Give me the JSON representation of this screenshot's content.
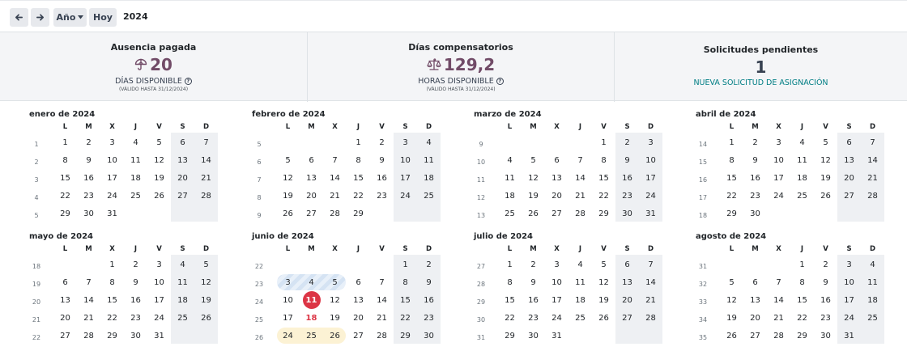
{
  "toolbar": {
    "prev_icon": "arrow-left-icon",
    "next_icon": "arrow-right-icon",
    "scale_label": "Año",
    "today_label": "Hoy",
    "year": "2024"
  },
  "summary": {
    "paid": {
      "title": "Ausencia pagada",
      "icon": "umbrella-icon",
      "value": "20",
      "unit": "DÍAS DISPONIBLE",
      "valid": "(VÁLIDO HASTA 31/12/2024)"
    },
    "comp": {
      "title": "Días compensatorios",
      "icon": "scale-icon",
      "value": "129,2",
      "unit": "HORAS DISPONIBLE",
      "valid": "(VÁLIDO HASTA 31/12/2024)"
    },
    "pending": {
      "title": "Solicitudes pendientes",
      "value": "1",
      "link": "NUEVA SOLICITUD DE ASIGNACIÓN"
    }
  },
  "colors": {
    "accent": "#714b67",
    "link": "#017e84",
    "today": "#dc3545",
    "weekend": "#eef0f3"
  },
  "weekday_headers": [
    "L",
    "M",
    "X",
    "J",
    "V",
    "S",
    "D"
  ],
  "months": [
    {
      "title": "enero de 2024",
      "offset": 0,
      "days": 31,
      "weeks": [
        "1",
        "2",
        "3",
        "4",
        "5"
      ]
    },
    {
      "title": "febrero de 2024",
      "offset": 3,
      "days": 29,
      "weeks": [
        "5",
        "6",
        "7",
        "8",
        "9"
      ]
    },
    {
      "title": "marzo de 2024",
      "offset": 4,
      "days": 31,
      "weeks": [
        "9",
        "10",
        "11",
        "12",
        "13"
      ]
    },
    {
      "title": "abril de 2024",
      "offset": 0,
      "days": 30,
      "weeks": [
        "14",
        "15",
        "16",
        "17",
        "18"
      ]
    },
    {
      "title": "mayo de 2024",
      "offset": 2,
      "days": 31,
      "weeks": [
        "18",
        "19",
        "20",
        "21",
        "22"
      ]
    },
    {
      "title": "junio de 2024",
      "offset": 5,
      "days": 30,
      "weeks": [
        "22",
        "23",
        "24",
        "25",
        "26"
      ]
    },
    {
      "title": "julio de 2024",
      "offset": 0,
      "days": 31,
      "weeks": [
        "27",
        "28",
        "29",
        "30",
        "31"
      ]
    },
    {
      "title": "agosto de 2024",
      "offset": 3,
      "days": 31,
      "weeks": [
        "31",
        "32",
        "33",
        "34",
        "35"
      ]
    }
  ],
  "highlights": {
    "month": "junio de 2024",
    "today": 11,
    "public_holiday": 18,
    "approved_leave": [
      3,
      4,
      5
    ],
    "pending_leave": [
      24,
      25,
      26
    ]
  }
}
